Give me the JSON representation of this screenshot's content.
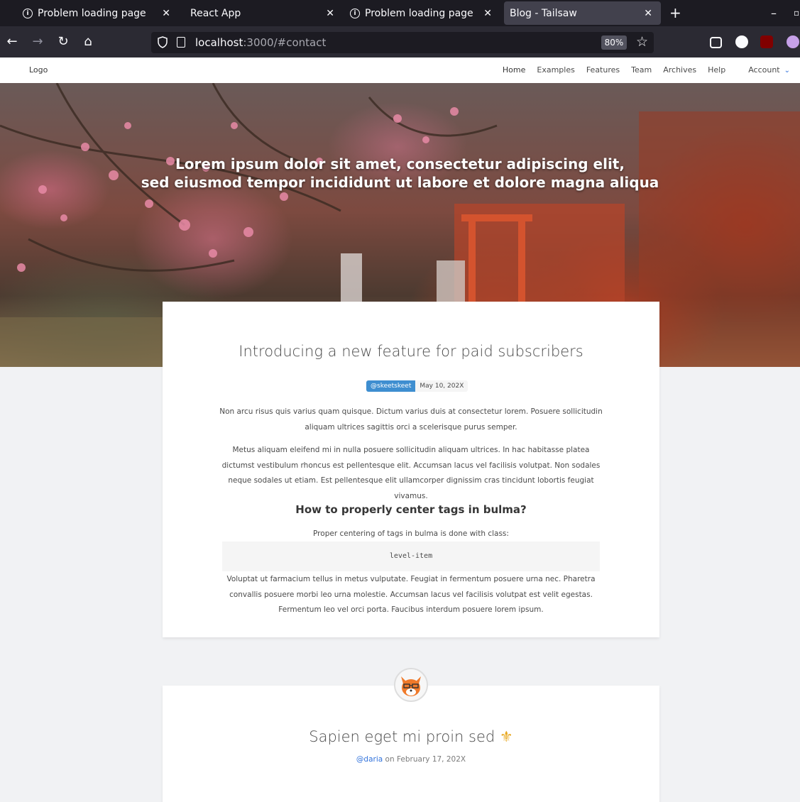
{
  "browser": {
    "tabs": [
      {
        "title": "Problem loading page",
        "icon": "info-icon"
      },
      {
        "title": "React App"
      },
      {
        "title": "Problem loading page",
        "icon": "info-icon"
      },
      {
        "title": "Blog - Tailsaw",
        "active": true
      }
    ],
    "url_host": "localhost",
    "url_rest": ":3000/#contact",
    "zoom": "80%"
  },
  "site": {
    "logo": "Logo",
    "menu": [
      "Home",
      "Examples",
      "Features",
      "Team",
      "Archives",
      "Help",
      "Account"
    ],
    "hero_line1": "Lorem ipsum dolor sit amet, consectetur adipiscing elit,",
    "hero_line2": "sed eiusmod tempor incididunt ut labore et dolore magna aliqua"
  },
  "post1": {
    "title": "Introducing a new feature for paid subscribers",
    "user_tag": "@skeetskeet",
    "date_tag": "May 10, 202X",
    "p1": "Non arcu risus quis varius quam quisque. Dictum varius duis at consectetur lorem. Posuere sollicitudin aliquam ultrices sagittis orci a scelerisque purus semper.",
    "p2": "Metus aliquam eleifend mi in nulla posuere sollicitudin aliquam ultrices. In hac habitasse platea dictumst vestibulum rhoncus est pellentesque elit. Accumsan lacus vel facilisis volutpat. Non sodales neque sodales ut etiam. Est pellentesque elit ullamcorper dignissim cras tincidunt lobortis feugiat vivamus.",
    "subheading": "How to properly center tags in bulma?",
    "p3": "Proper centering of tags in bulma is done with class:",
    "code": "level-item",
    "p4": "Voluptat ut farmacium tellus in metus vulputate. Feugiat in fermentum posuere urna nec. Pharetra convallis posuere morbi leo urna molestie. Accumsan lacus vel facilisis volutpat est velit egestas. Fermentum leo vel orci porta. Faucibus interdum posuere lorem ipsum."
  },
  "post2": {
    "title": "Sapien eget mi proin sed",
    "emoji": "⚜",
    "author": "@daria",
    "on": "on February 17, 202X"
  }
}
